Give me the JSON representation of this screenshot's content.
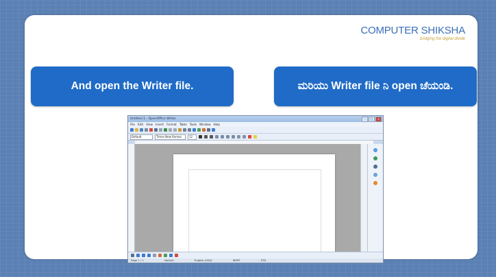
{
  "logo": {
    "brand_a": "COMPUTER",
    "brand_b": "SHIKSHA",
    "tagline": "bridging the digital divide"
  },
  "callouts": {
    "english": "And open the Writer file.",
    "kannada": "ಮರಿಯು Writer file ನಿ open ಚೆಯಂಡಿ."
  },
  "screenshot": {
    "window_title": "Untitled 1 - OpenOffice Writer",
    "menu": [
      "File",
      "Edit",
      "View",
      "Insert",
      "Format",
      "Table",
      "Tools",
      "Window",
      "Help"
    ],
    "style_value": "Default",
    "font_value": "Times New Roman",
    "size_value": "12",
    "status": [
      "Page 1 / 1",
      "Default",
      "English (USA)",
      "INSRT",
      "STD"
    ]
  },
  "colors": {
    "background": "#5b80b4",
    "callout": "#1f6bc7",
    "brand": "#3a6fb8"
  }
}
